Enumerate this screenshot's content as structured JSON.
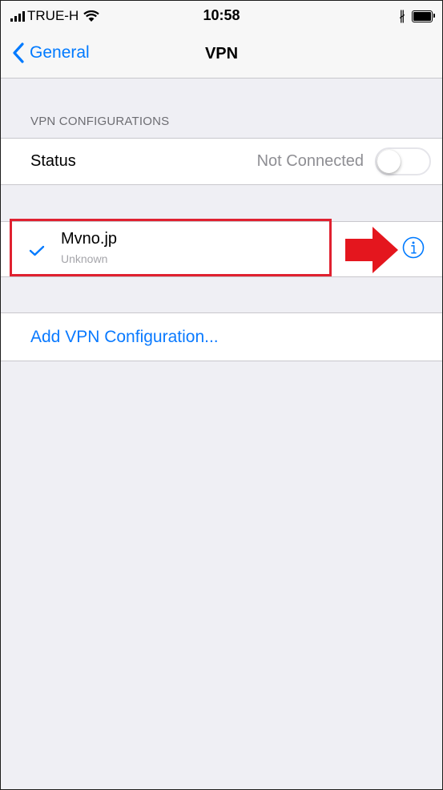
{
  "status_bar": {
    "carrier": "TRUE-H",
    "time": "10:58",
    "icons": [
      "signal-icon",
      "wifi-icon",
      "bluetooth-icon",
      "battery-icon"
    ]
  },
  "nav": {
    "back_label": "General",
    "title": "VPN"
  },
  "section": {
    "header": "VPN CONFIGURATIONS"
  },
  "status_row": {
    "label": "Status",
    "value": "Not Connected",
    "toggle_on": false
  },
  "configuration": {
    "name": "Mvno.jp",
    "subtitle": "Unknown",
    "selected": true
  },
  "add_row": {
    "label": "Add VPN Configuration..."
  },
  "colors": {
    "accent": "#007aff",
    "highlight": "#e02130",
    "background": "#efeff4"
  }
}
